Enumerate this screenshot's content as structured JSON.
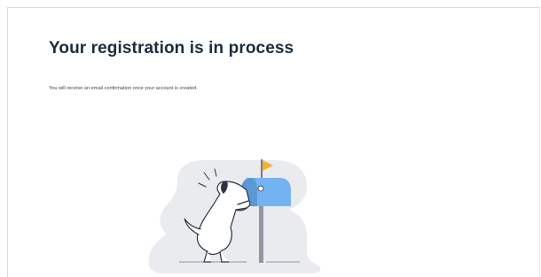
{
  "page": {
    "title": "Your registration is in process",
    "message": "You will receive an email confirmation once your account is created."
  },
  "illustration": {
    "subject": "dog-peeking-into-mailbox",
    "colors": {
      "background_blob": "#e9ebee",
      "mailbox": "#74b3f2",
      "mailbox_shadow": "#5a98d6",
      "flag": "#f5b32b",
      "post": "#8e97a2",
      "dog": "#ffffff",
      "outline": "#2b3440"
    }
  }
}
